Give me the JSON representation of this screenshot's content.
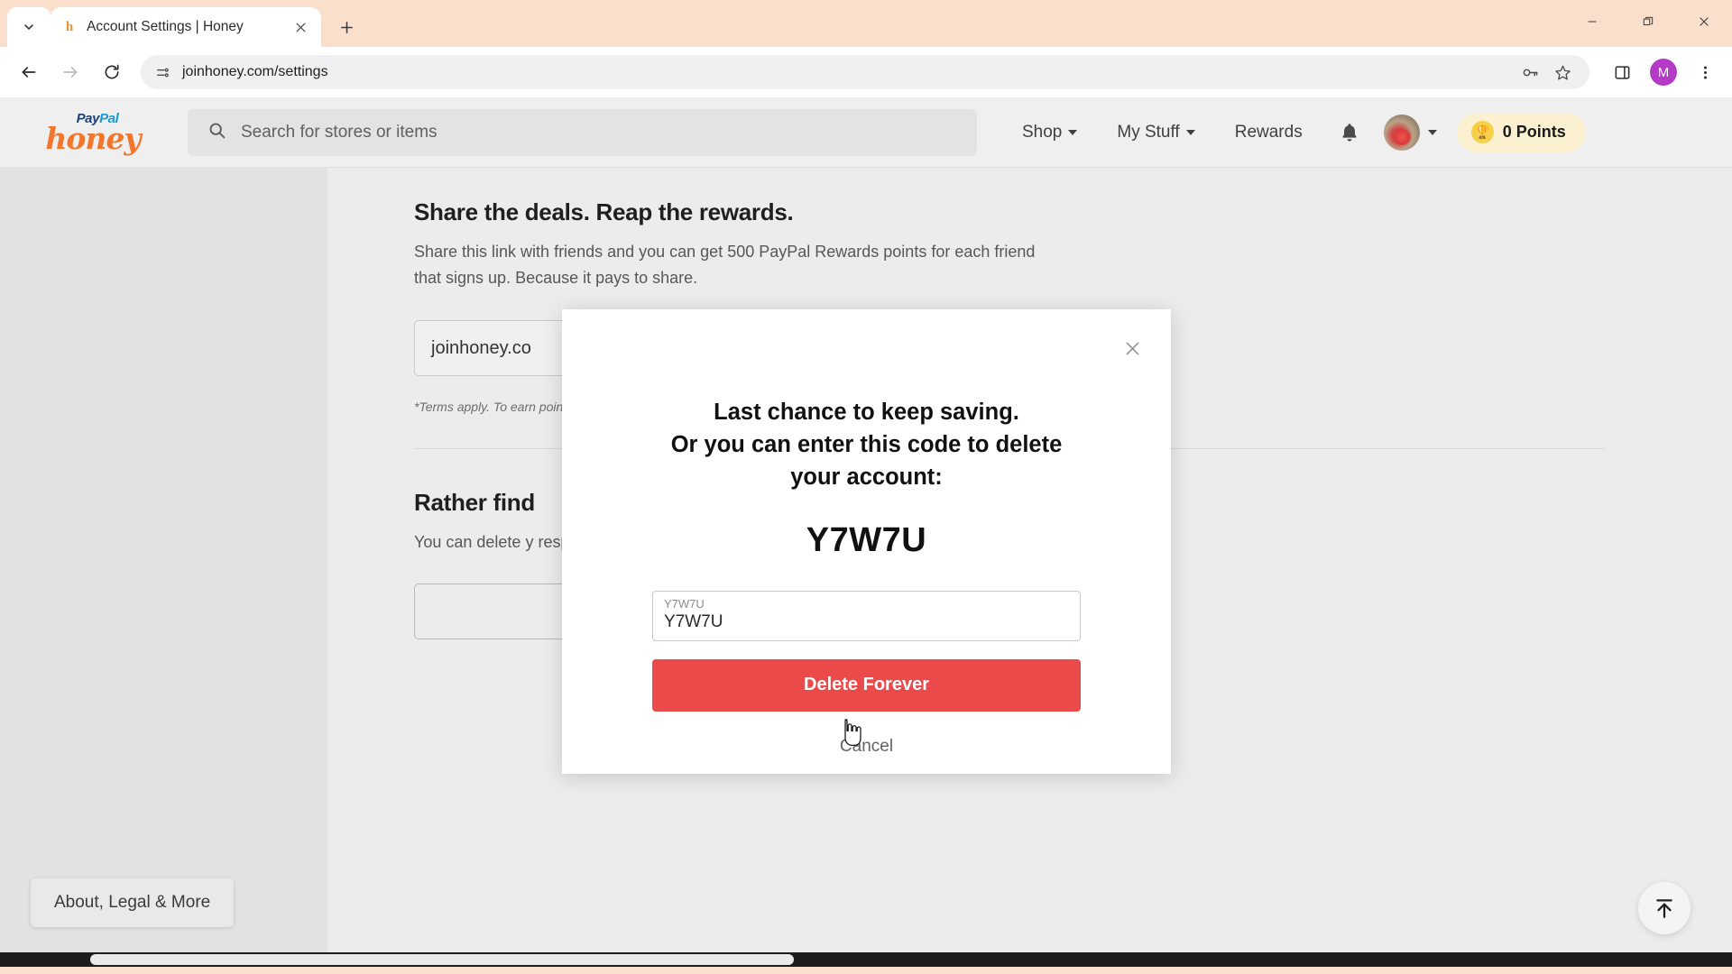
{
  "browser": {
    "tab": {
      "title": "Account Settings | Honey",
      "favicon": "honey-favicon",
      "close_label": "×"
    },
    "new_tab_label": "+",
    "omnibox": {
      "url": "joinhoney.com/settings",
      "site_info_icon": "page-info-icon",
      "key_icon": "password-key-icon",
      "bookmark_icon": "star-icon"
    },
    "toolbar": {
      "back_icon": "back-arrow-icon",
      "forward_icon": "forward-arrow-icon",
      "reload_icon": "reload-icon",
      "side_panel_icon": "side-panel-icon",
      "menu_icon": "three-dot-menu-icon",
      "profile_initial": "M"
    },
    "window": {
      "minimize": "minimize-icon",
      "maximize": "restore-icon",
      "close": "close-icon"
    }
  },
  "site": {
    "logo": {
      "top": "Pay",
      "top2": "Pal",
      "main": "honey"
    },
    "search": {
      "placeholder": "Search for stores or items",
      "icon": "search-icon"
    },
    "nav": [
      {
        "label": "Shop",
        "has_caret": true
      },
      {
        "label": "My Stuff",
        "has_caret": true
      },
      {
        "label": "Rewards",
        "has_caret": false
      }
    ],
    "bell_icon": "notification-bell-icon",
    "avatar_caret": "chevron-down-icon",
    "points": {
      "icon": "trophy-icon",
      "label": "0 Points"
    }
  },
  "content": {
    "referral": {
      "title": "Share the deals. Reap the rewards.",
      "body": "Share this link with friends and you can get 500 PayPal Rewards points for each friend that signs up. Because it pays to share.",
      "link_value": "joinhoney.co",
      "terms": "*Terms apply. To earn points on a qualifying receive."
    },
    "delete_section": {
      "title": "Rather find",
      "body": "You can delete y respect your ch once you decide"
    },
    "about_pill": "About, Legal & More",
    "scroll_top_icon": "scroll-to-top-icon"
  },
  "modal": {
    "close_icon": "close-icon",
    "heading_line1": "Last chance to keep saving.",
    "heading_line2": "Or you can enter this code to delete your account:",
    "code": "Y7W7U",
    "input": {
      "label": "Y7W7U",
      "value": "Y7W7U",
      "placeholder": "Y7W7U"
    },
    "confirm_label": "Delete Forever",
    "cancel_label": "Cancel",
    "confirm_color": "#ea4a4a"
  }
}
